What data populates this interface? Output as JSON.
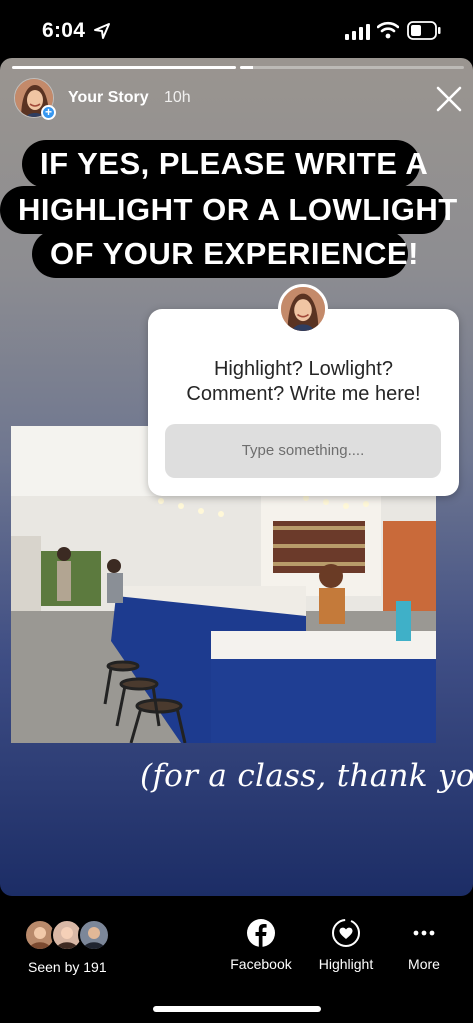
{
  "status_bar": {
    "time": "6:04",
    "icons": [
      "location-arrow-icon",
      "cellular-signal-icon",
      "wifi-icon",
      "battery-icon"
    ]
  },
  "story": {
    "progress": [
      1.0,
      0.06
    ],
    "username": "Your Story",
    "time_ago": "10h",
    "heading_lines": [
      "IF YES, PLEASE WRITE A",
      "HIGHLIGHT OR A LOWLIGHT",
      "OF YOUR EXPERIENCE!"
    ],
    "question_sticker": {
      "prompt_lines": [
        "Highlight? Lowlight?",
        "Comment? Write me here!"
      ],
      "placeholder": "Type something...."
    },
    "caption": "(for a class, thank you!)"
  },
  "footer": {
    "seen_by": "Seen by 191",
    "actions": [
      {
        "label": "Facebook",
        "icon": "facebook-icon"
      },
      {
        "label": "Highlight",
        "icon": "highlight-heart-icon"
      },
      {
        "label": "More",
        "icon": "more-dots-icon"
      }
    ]
  },
  "colors": {
    "plus_badge": "#3797f0",
    "bar_counter": "#1f3e93",
    "gradient_top": "#9a9590",
    "gradient_bottom": "#1c2d66"
  }
}
